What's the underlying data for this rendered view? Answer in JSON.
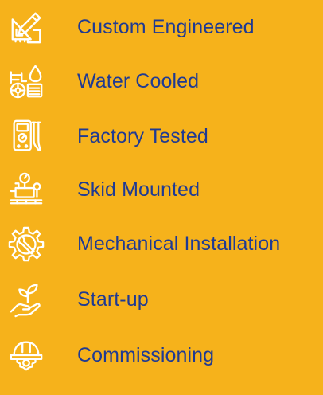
{
  "colors": {
    "background": "#F6B21B",
    "text": "#1F3A93",
    "icon": "#FFFFFF"
  },
  "features": [
    {
      "icon": "drafting-tools-icon",
      "label": "Custom Engineered"
    },
    {
      "icon": "water-cooled-pump-icon",
      "label": "Water Cooled"
    },
    {
      "icon": "multimeter-icon",
      "label": "Factory Tested"
    },
    {
      "icon": "skid-gauge-icon",
      "label": "Skid Mounted"
    },
    {
      "icon": "gear-wrench-icon",
      "label": "Mechanical Installation"
    },
    {
      "icon": "sprout-hand-icon",
      "label": "Start-up"
    },
    {
      "icon": "hard-hat-gear-icon",
      "label": "Commissioning"
    }
  ]
}
